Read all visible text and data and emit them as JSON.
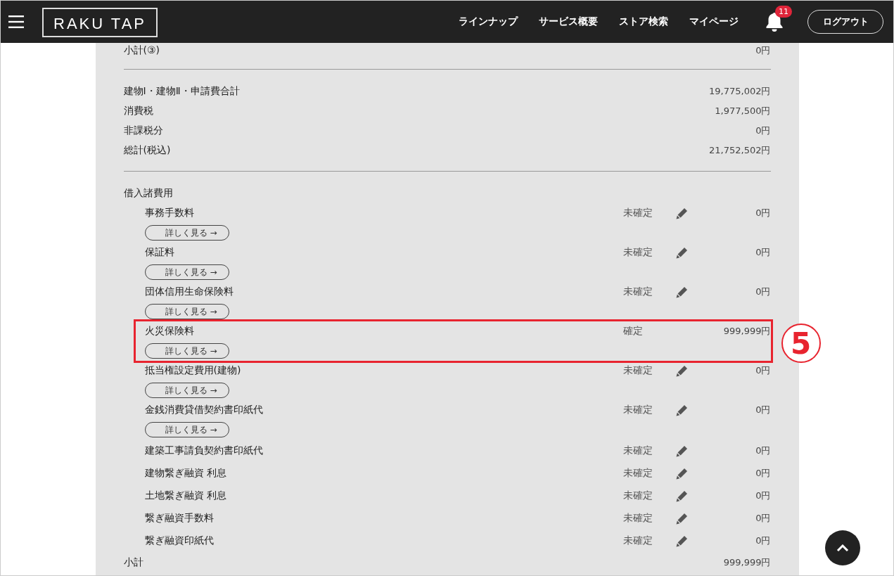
{
  "header": {
    "logo": "RAKU TAP",
    "nav": [
      "ラインナップ",
      "サービス概要",
      "ストア検索",
      "マイページ"
    ],
    "notification_count": "11",
    "logout": "ログアウト"
  },
  "subtotal_3": {
    "label": "小計(③)",
    "amount": "0円"
  },
  "totals": [
    {
      "label": "建物Ⅰ・建物Ⅱ・申請費合計",
      "amount": "19,775,002円"
    },
    {
      "label": "消費税",
      "amount": "1,977,500円"
    },
    {
      "label": "非課税分",
      "amount": "0円"
    },
    {
      "label": "総計(税込)",
      "amount": "21,752,502円"
    }
  ],
  "loan_costs": {
    "heading": "借入諸費用",
    "items": [
      {
        "name": "事務手数料",
        "status": "未確定",
        "editable": true,
        "amount": "0円",
        "details_link": "詳しく見る →",
        "highlighted": false
      },
      {
        "name": "保証料",
        "status": "未確定",
        "editable": true,
        "amount": "0円",
        "details_link": "詳しく見る →",
        "highlighted": false
      },
      {
        "name": "団体信用生命保険料",
        "status": "未確定",
        "editable": true,
        "amount": "0円",
        "details_link": "詳しく見る →",
        "highlighted": false
      },
      {
        "name": "火災保険料",
        "status": "確定",
        "editable": false,
        "amount": "999,999円",
        "details_link": "詳しく見る →",
        "highlighted": true
      },
      {
        "name": "抵当権設定費用(建物)",
        "status": "未確定",
        "editable": true,
        "amount": "0円",
        "details_link": "詳しく見る →",
        "highlighted": false
      },
      {
        "name": "金銭消費貸借契約書印紙代",
        "status": "未確定",
        "editable": true,
        "amount": "0円",
        "details_link": "詳しく見る →",
        "highlighted": false
      },
      {
        "name": "建築工事請負契約書印紙代",
        "status": "未確定",
        "editable": true,
        "amount": "0円",
        "highlighted": false
      },
      {
        "name": "建物繋ぎ融資 利息",
        "status": "未確定",
        "editable": true,
        "amount": "0円",
        "highlighted": false
      },
      {
        "name": "土地繋ぎ融資 利息",
        "status": "未確定",
        "editable": true,
        "amount": "0円",
        "highlighted": false
      },
      {
        "name": "繋ぎ融資手数料",
        "status": "未確定",
        "editable": true,
        "amount": "0円",
        "highlighted": false
      },
      {
        "name": "繋ぎ融資印紙代",
        "status": "未確定",
        "editable": true,
        "amount": "0円",
        "highlighted": false
      }
    ],
    "subtotal": {
      "label": "小計",
      "amount": "999,999円"
    }
  },
  "annotation": {
    "label": "5"
  }
}
